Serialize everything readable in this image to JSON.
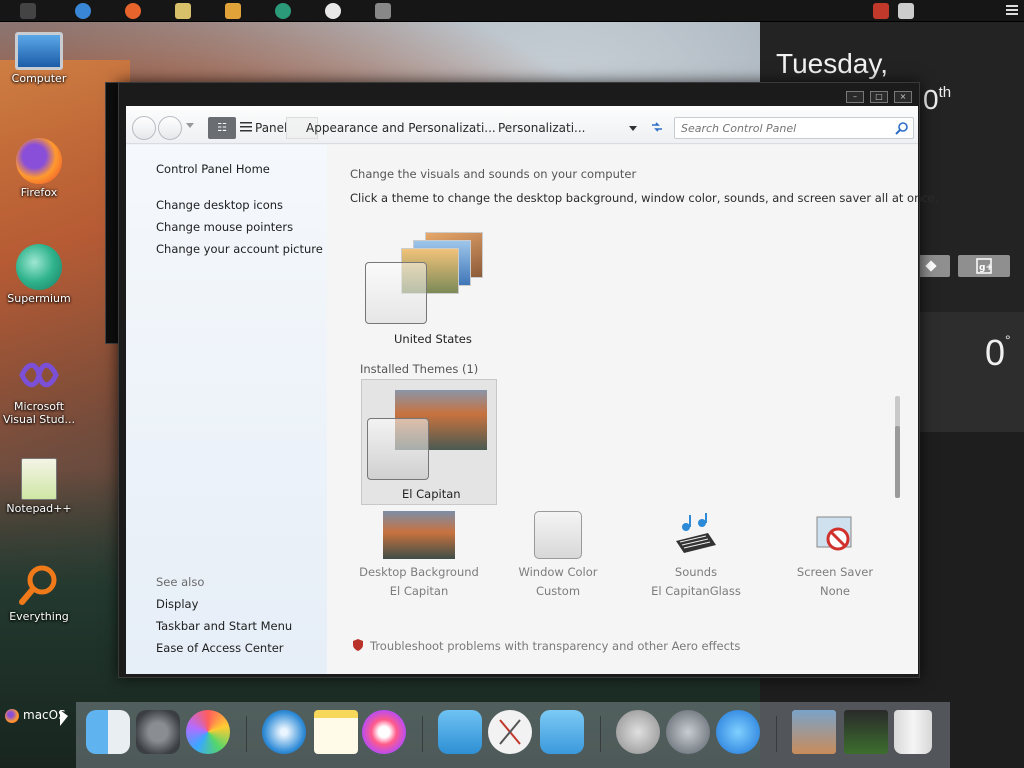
{
  "desktop": {
    "icons": [
      {
        "label": "Computer",
        "icon": "monitor-icon"
      },
      {
        "label": "Firefox",
        "icon": "firefox-icon"
      },
      {
        "label": "Supermium",
        "icon": "supermium-icon"
      },
      {
        "label": "Microsoft Visual Stud...",
        "icon": "visual-studio-icon"
      },
      {
        "label": "Notepad++",
        "icon": "notepad-plus-plus-icon"
      },
      {
        "label": "Everything",
        "icon": "search-magnifier-icon"
      }
    ]
  },
  "widget": {
    "day": "Tuesday,",
    "date_suffix": "0",
    "date_ordinal": "th",
    "temperature": "0",
    "temperature_unit": "°"
  },
  "control_panel": {
    "breadcrumb": [
      "Panel",
      "Appearance and Personalizati...",
      "Personalizati..."
    ],
    "search_placeholder": "Search Control Panel",
    "left_links": {
      "home": "Control Panel Home",
      "desktop_icons": "Change desktop icons",
      "mouse_pointers": "Change mouse pointers",
      "account_picture": "Change your account picture"
    },
    "see_also": {
      "heading": "See also",
      "display": "Display",
      "taskbar": "Taskbar and Start Menu",
      "ease": "Ease of Access Center"
    },
    "main": {
      "heading": "Change the visuals and sounds on your computer",
      "description": "Click a theme to change the desktop background, window color, sounds, and screen saver all at once.",
      "theme_united_states": "United States",
      "installed_heading": "Installed Themes (1)",
      "theme_el_capitan": "El Capitan"
    },
    "bottom": [
      {
        "title": "Desktop Background",
        "value": "El Capitan",
        "icon": "desktop-background-icon"
      },
      {
        "title": "Window Color",
        "value": "Custom",
        "icon": "window-color-icon"
      },
      {
        "title": "Sounds",
        "value": "El CapitanGlass",
        "icon": "sounds-icon"
      },
      {
        "title": "Screen Saver",
        "value": "None",
        "icon": "screen-saver-icon"
      }
    ],
    "troubleshoot": "Troubleshoot problems with transparency and other Aero effects"
  },
  "dock": {
    "start_label": "macOS"
  },
  "colors": {
    "accent_blue": "#2d6fc7",
    "panel_dark": "#1e1e1e"
  }
}
